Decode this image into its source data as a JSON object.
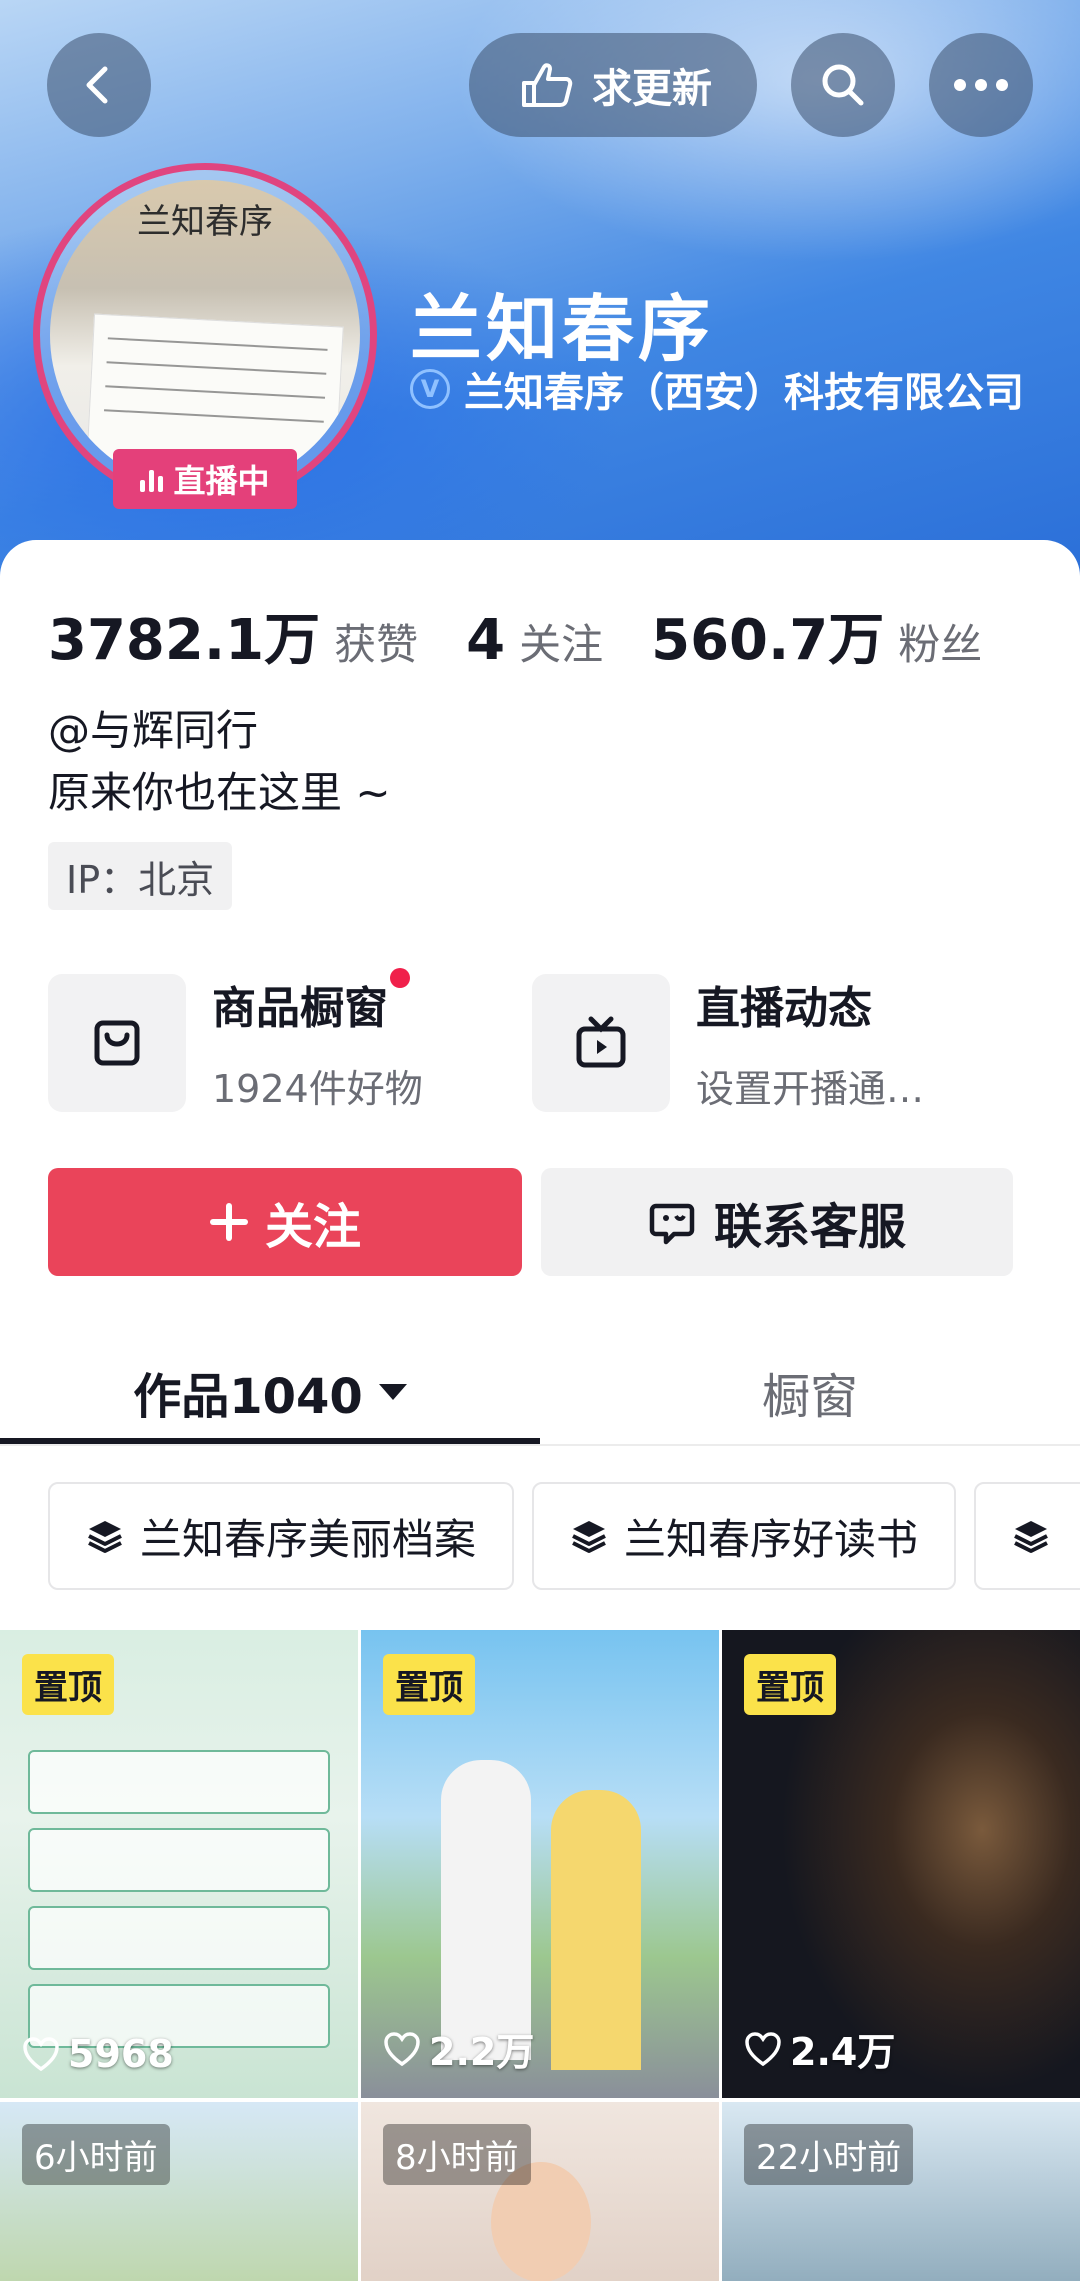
{
  "header": {
    "request_update_label": "求更新",
    "profile_name": "兰知春序",
    "verified_badge": "V",
    "company": "兰知春序（西安）科技有限公司",
    "live_badge": "直播中",
    "avatar_logo_text": "兰知春序"
  },
  "stats": [
    {
      "value": "3782.1万",
      "label": "获赞"
    },
    {
      "value": "4",
      "label": "关注"
    },
    {
      "value": "560.7万",
      "label": "粉丝"
    }
  ],
  "bio": {
    "line1": "@与辉同行",
    "line2": "原来你也在这里 ~",
    "ip": "IP：北京"
  },
  "features": [
    {
      "title": "商品橱窗",
      "subtitle": "1924件好物",
      "icon": "shopping-bag-icon",
      "has_dot": true
    },
    {
      "title": "直播动态",
      "subtitle": "设置开播通…",
      "icon": "tv-icon",
      "has_dot": false
    }
  ],
  "actions": {
    "follow": "关注",
    "contact": "联系客服"
  },
  "tabs": {
    "works": "作品1040",
    "window": "橱窗"
  },
  "collections": [
    {
      "label": "兰知春序美丽档案"
    },
    {
      "label": "兰知春序好读书"
    },
    {
      "label": ""
    }
  ],
  "videos": [
    {
      "pinned": "置顶",
      "likes": "5968"
    },
    {
      "pinned": "置顶",
      "likes": "2.2万"
    },
    {
      "pinned": "置顶",
      "likes": "2.4万"
    },
    {
      "time_ago": "6小时前"
    },
    {
      "time_ago": "8小时前"
    },
    {
      "time_ago": "22小时前"
    }
  ],
  "colors": {
    "accent": "#ea445a",
    "live": "#e4407a",
    "pin": "#fbe24a"
  }
}
